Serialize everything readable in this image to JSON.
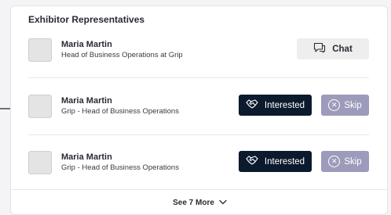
{
  "section": {
    "title": "Exhibitor Representatives"
  },
  "representatives": [
    {
      "name": "Maria Martin",
      "role": "Head of Business Operations at Grip",
      "action": "Chat"
    },
    {
      "name": "Maria Martin",
      "role": "Grip - Head of Business Operations",
      "interested_label": "Interested",
      "skip_label": "Skip"
    },
    {
      "name": "Maria Martin",
      "role": "Grip - Head of Business Operations",
      "interested_label": "Interested",
      "skip_label": "Skip"
    }
  ],
  "footer": {
    "see_more_label": "See 7 More"
  },
  "colors": {
    "interested_bg": "#0c1a2e",
    "skip_bg": "#9d9bbb",
    "chat_bg": "#eeeeef",
    "connector": "#1a2535"
  }
}
